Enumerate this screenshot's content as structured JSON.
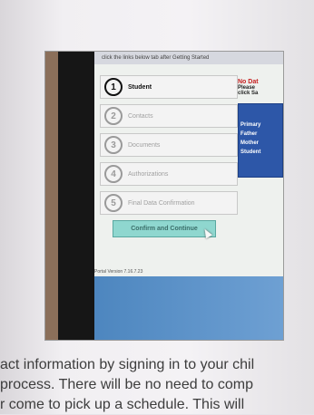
{
  "screen": {
    "top_banner": "click the links below tab after Getting Started",
    "steps": [
      {
        "num": "1",
        "label": "Student",
        "active": true
      },
      {
        "num": "2",
        "label": "Contacts",
        "active": false
      },
      {
        "num": "3",
        "label": "Documents",
        "active": false
      },
      {
        "num": "4",
        "label": "Authorizations",
        "active": false
      },
      {
        "num": "5",
        "label": "Final Data Confirmation",
        "active": false
      }
    ],
    "confirm_button": "Confirm and Continue",
    "version": "Portal Version 7.16.7.23",
    "right_panel": {
      "line1": "No Dat",
      "line2": "Please",
      "line3": "click Sa",
      "blue_lines": [
        "Primary",
        "Father",
        "Mother",
        "Student"
      ]
    }
  },
  "page_text": {
    "line1": "act information by signing in to your chil",
    "line2": "process. There will be no need to comp",
    "line3": "r come to pick up a schedule. This will"
  }
}
